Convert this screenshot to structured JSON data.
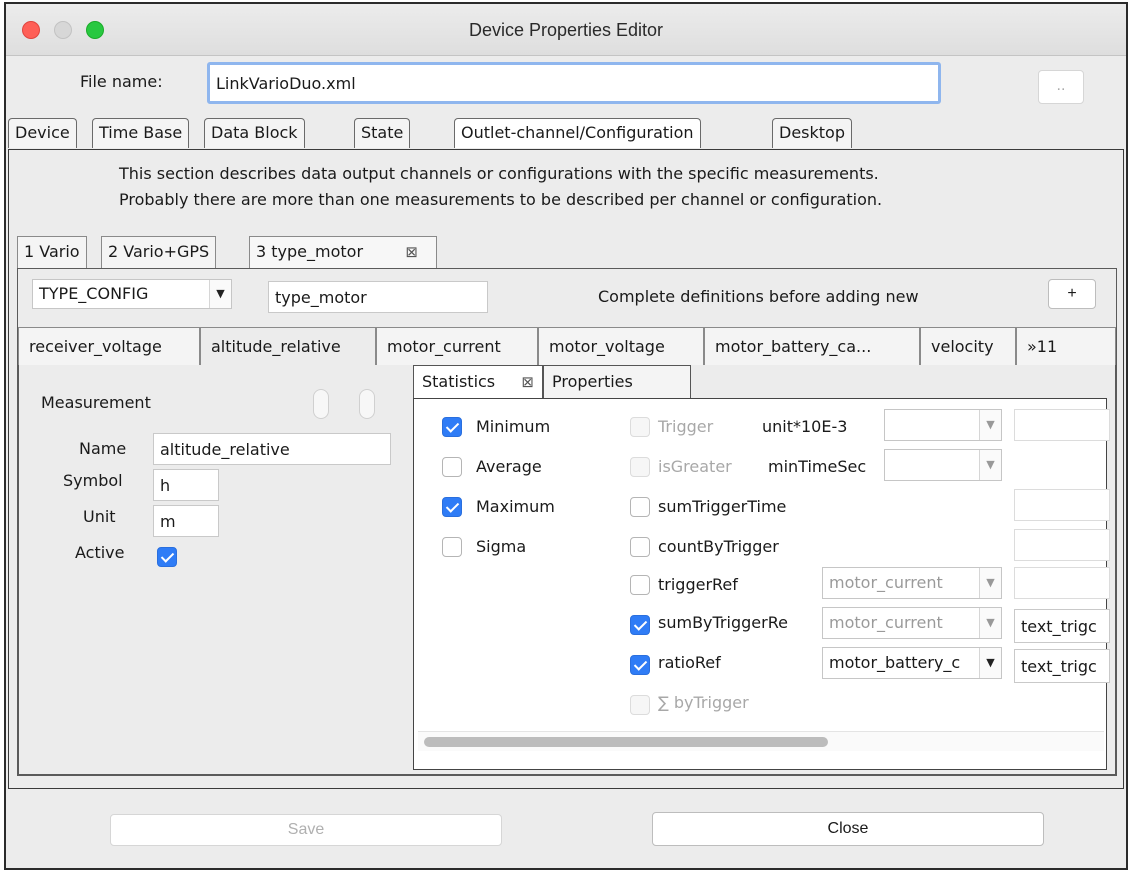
{
  "window": {
    "title": "Device Properties Editor",
    "traffic_lights": [
      "close",
      "minimize",
      "zoom"
    ]
  },
  "file": {
    "label": "File name:",
    "value": "LinkVarioDuo.xml",
    "browse_label": ".."
  },
  "main_tabs": [
    {
      "label": "Device"
    },
    {
      "label": "Time Base"
    },
    {
      "label": "Data Block"
    },
    {
      "label": "State"
    },
    {
      "label": "Outlet-channel/Configuration",
      "selected": true
    },
    {
      "label": "Desktop"
    }
  ],
  "description": {
    "line1": "This section describes data output channels or configurations with the specific measurements.",
    "line2": "Probably there are more than one measurements to be described per channel or configuration."
  },
  "channel_tabs": [
    {
      "label": "1 Vario"
    },
    {
      "label": "2 Vario+GPS"
    },
    {
      "label": "3 type_motor",
      "selected": true,
      "close_icon": "close-icon"
    }
  ],
  "channel_config": {
    "type_value": "TYPE_CONFIG",
    "name_value": "type_motor",
    "hint": "Complete definitions before adding new",
    "add_label": "+"
  },
  "measurement_tabs": [
    {
      "label": "receiver_voltage"
    },
    {
      "label": "altitude_relative",
      "selected": true
    },
    {
      "label": "motor_current"
    },
    {
      "label": "motor_voltage"
    },
    {
      "label": "motor_battery_ca..."
    },
    {
      "label": "velocity"
    },
    {
      "label": "»11"
    }
  ],
  "measurement": {
    "header": "Measurement",
    "name_label": "Name",
    "name_value": "altitude_relative",
    "symbol_label": "Symbol",
    "symbol_value": "h",
    "unit_label": "Unit",
    "unit_value": "m",
    "active_label": "Active",
    "active_checked": true
  },
  "stats_tabs": [
    {
      "label": "Statistics",
      "selected": true,
      "close_icon": "close-icon"
    },
    {
      "label": "Properties"
    }
  ],
  "statistics": {
    "left": [
      {
        "label": "Minimum",
        "checked": true
      },
      {
        "label": "Average",
        "checked": false
      },
      {
        "label": "Maximum",
        "checked": true
      },
      {
        "label": "Sigma",
        "checked": false
      }
    ],
    "right": [
      {
        "label": "Trigger",
        "checked": false,
        "disabled": true
      },
      {
        "label": "isGreater",
        "checked": false,
        "disabled": true
      },
      {
        "label": "sumTriggerTime",
        "checked": false
      },
      {
        "label": "countByTrigger",
        "checked": false
      },
      {
        "label": "triggerRef",
        "checked": false
      },
      {
        "label": "sumByTriggerRe",
        "checked": true
      },
      {
        "label": "ratioRef",
        "checked": true
      },
      {
        "label": "∑ byTrigger",
        "checked": false,
        "disabled": true
      }
    ],
    "unit_label": "unit*10E-3",
    "min_time_label": "minTimeSec",
    "trigger_ref_value": "motor_current",
    "sum_by_trigger_ref_value": "motor_current",
    "ratio_ref_value": "motor_battery_c",
    "sum_by_trigger_text": "text_trigc",
    "ratio_text": "text_trigc"
  },
  "footer": {
    "save_label": "Save",
    "close_label": "Close"
  }
}
